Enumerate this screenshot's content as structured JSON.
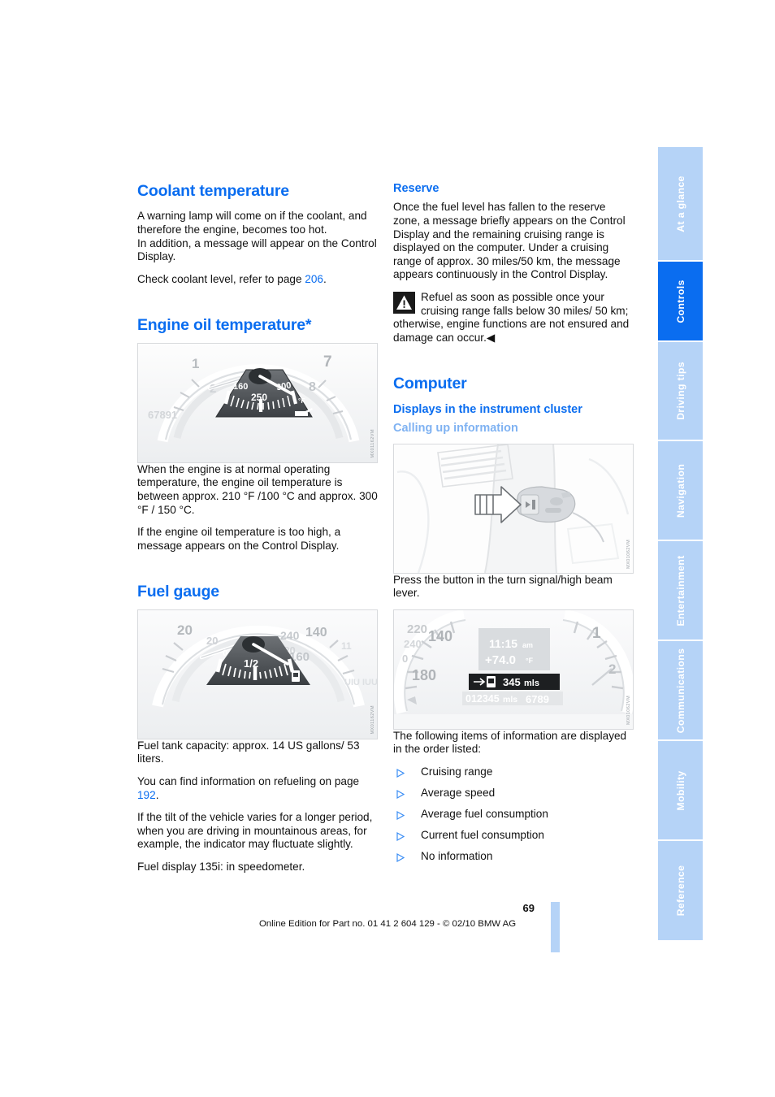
{
  "page": {
    "number": "69",
    "footer": "Online Edition for Part no. 01 41 2 604 129 - © 02/10 BMW AG"
  },
  "left_column": {
    "coolant": {
      "heading": "Coolant temperature",
      "p1": "A warning lamp will come on if the coolant, and therefore the engine, becomes too hot.",
      "p2": "In addition, a message will appear on the Control Display.",
      "p3_pre": "Check coolant level, refer to page ",
      "p3_ref": "206",
      "p3_post": "."
    },
    "oil": {
      "heading": "Engine oil temperature*",
      "figure": {
        "name": "engine-oil-temperature-gauge",
        "code": "MX01162VM",
        "ticks": [
          "160",
          "250",
          "300"
        ],
        "unit": "°F",
        "odometer": "67891",
        "tach_labels": [
          "1",
          "2",
          "7",
          "8"
        ]
      },
      "p1": "When the engine is at normal operating temperature, the engine oil temperature is between approx. 210 °F /100 °C and approx. 300 °F / 150 °C.",
      "p2": "If the engine oil temperature is too high, a message appears on the Control Display."
    },
    "fuel": {
      "heading": "Fuel gauge",
      "figure": {
        "name": "fuel-gauge",
        "code": "MX01162VM",
        "ticks": [
          "0",
          "1/2"
        ],
        "speedo_labels": [
          "20",
          "20",
          "240",
          "140",
          "220",
          "160"
        ]
      },
      "p1": "Fuel tank capacity: approx. 14 US gallons/ 53 liters.",
      "p2_pre": "You can find information on refueling on page ",
      "p2_ref": "192",
      "p2_post": ".",
      "p3": "If the tilt of the vehicle varies for a longer period, when you are driving in mountainous areas, for example, the indicator may fluctuate slightly.",
      "p4": "Fuel display 135i: in speedometer."
    }
  },
  "right_column": {
    "reserve": {
      "heading": "Reserve",
      "p1": "Once the fuel level has fallen to the reserve zone, a message briefly appears on the Control Display and the remaining cruising range is displayed on the computer. Under a cruising range of approx. 30 miles/50 km, the message appears continuously in the Control Display.",
      "warning": "Refuel as soon as possible once your cruising range falls below 30 miles/ 50 km; otherwise, engine functions are not ensured and damage can occur.◀",
      "warning_icon": "warning-triangle-icon"
    },
    "computer": {
      "heading": "Computer",
      "subheading": "Displays in the instrument cluster",
      "subsubheading": "Calling up information",
      "lever_figure": {
        "name": "turn-signal-high-beam-lever",
        "code": "MX01062VM"
      },
      "lever_caption": "Press the button in the turn signal/high beam lever.",
      "cluster_figure": {
        "name": "instrument-cluster-display",
        "code": "MX01062VM",
        "time": "11:15 am",
        "temperature": "+74.0 °F",
        "cruising_range": "345 mls",
        "odometer": "012345 mls",
        "trip": "6789",
        "speedo_labels": [
          "220",
          "240",
          "140",
          "0",
          "180",
          "1",
          "2"
        ]
      },
      "list_intro": "The following items of information are displayed in the order listed:",
      "list_items": [
        "Cruising range",
        "Average speed",
        "Average fuel consumption",
        "Current fuel consumption",
        "No information"
      ]
    }
  },
  "sidebar": {
    "tabs": [
      {
        "label": "At a glance",
        "active": false
      },
      {
        "label": "Controls",
        "active": true
      },
      {
        "label": "Driving tips",
        "active": false
      },
      {
        "label": "Navigation",
        "active": false
      },
      {
        "label": "Entertainment",
        "active": false
      },
      {
        "label": "Communications",
        "active": false
      },
      {
        "label": "Mobility",
        "active": false
      },
      {
        "label": "Reference",
        "active": false
      }
    ]
  },
  "colors": {
    "accent_blue": "#0a6df0",
    "light_blue": "#b5d3f7",
    "mid_blue": "#7fb2f2",
    "text": "#111111"
  }
}
